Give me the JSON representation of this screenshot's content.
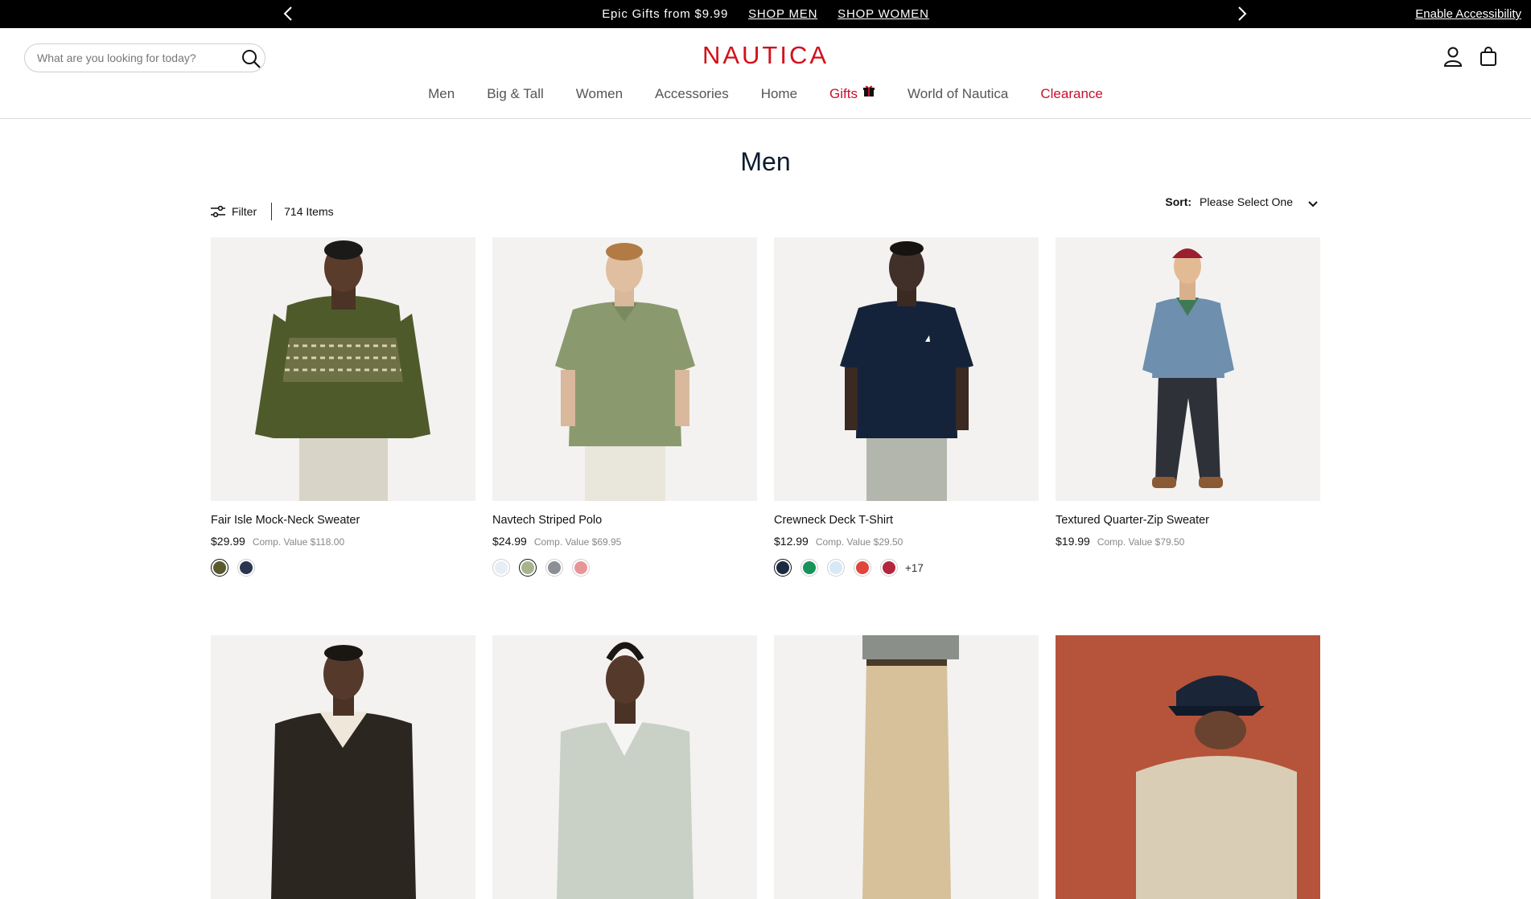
{
  "promo": {
    "message": "Epic Gifts from $9.99",
    "link_men": "SHOP MEN",
    "link_women": "SHOP WOMEN",
    "accessibility": "Enable Accessibility"
  },
  "header": {
    "logo": "NAUTICA",
    "search_placeholder": "What are you looking for today?",
    "nav": [
      "Men",
      "Big & Tall",
      "Women",
      "Accessories",
      "Home",
      "Gifts",
      "World of Nautica",
      "Clearance"
    ]
  },
  "page": {
    "title": "Men",
    "filter_label": "Filter",
    "item_count": "714 Items",
    "sort_label": "Sort:",
    "sort_value": "Please Select One"
  },
  "products": [
    {
      "name": "Fair Isle Mock-Neck Sweater",
      "price": "$29.99",
      "comp": "Comp. Value $118.00",
      "swatches": [
        "#5a5a2e",
        "#2a3550"
      ],
      "selected": 0,
      "more": ""
    },
    {
      "name": "Navtech Striped Polo",
      "price": "$24.99",
      "comp": "Comp. Value $69.95",
      "swatches": [
        "#e6edf4",
        "#a9b48c",
        "#8c8f93",
        "#e8959a"
      ],
      "selected": 1,
      "more": ""
    },
    {
      "name": "Crewneck Deck T-Shirt",
      "price": "$12.99",
      "comp": "Comp. Value $29.50",
      "swatches": [
        "#1a2a40",
        "#16935a",
        "#d6e9f5",
        "#e0463a",
        "#b5263e"
      ],
      "selected": 0,
      "more": "+17"
    },
    {
      "name": "Textured Quarter-Zip Sweater",
      "price": "$19.99",
      "comp": "Comp. Value $79.50",
      "swatches": [],
      "selected": -1,
      "more": ""
    }
  ],
  "colors": {
    "brand_red": "#d1111b",
    "clearance_red": "#c8102e",
    "title_navy": "#0d1b2e"
  }
}
